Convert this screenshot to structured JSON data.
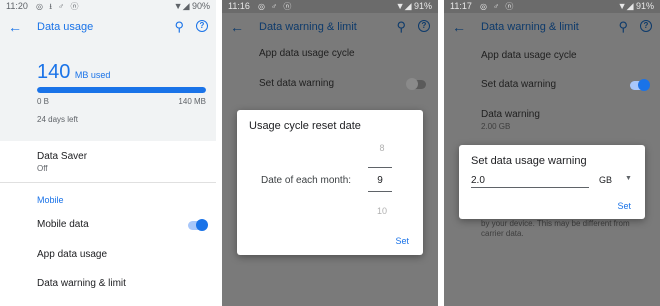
{
  "screen1": {
    "status": {
      "time": "11:20",
      "icons": "◎ ⭳ ♂ ⓝ",
      "right": "▼◢ 90%"
    },
    "title": "Data usage",
    "usage": {
      "amount": "140",
      "unit": "MB used",
      "min_label": "0 B",
      "max_label": "140 MB",
      "fill_fraction": 1.0,
      "days_left": "24 days left"
    },
    "data_saver": {
      "label": "Data Saver",
      "value": "Off"
    },
    "section_mobile": "Mobile",
    "mobile_data": {
      "label": "Mobile data",
      "toggle": "on"
    },
    "app_data_usage": "App data usage",
    "data_warning_limit": "Data warning & limit"
  },
  "screen2": {
    "status": {
      "time": "11:16",
      "icons": "◎ ♂ ⓝ",
      "right": "▼◢ 91%"
    },
    "title": "Data warning & limit",
    "cycle": "App data usage cycle",
    "set_warning": {
      "label": "Set data warning",
      "toggle": "off"
    },
    "dialog": {
      "title": "Usage cycle reset date",
      "label": "Date of each month:",
      "prev": "8",
      "value": "9",
      "next": "10",
      "button": "Set"
    }
  },
  "screen3": {
    "status": {
      "time": "11:17",
      "icons": "◎ ♂ ⓝ",
      "right": "▼◢ 91%"
    },
    "title": "Data warning & limit",
    "cycle": "App data usage cycle",
    "set_warning": {
      "label": "Set data warning",
      "toggle": "on"
    },
    "warning": {
      "label": "Data warning",
      "value": "2.00 GB"
    },
    "footnote": "by your device. This may be different from\ncarrier data.",
    "dialog": {
      "title": "Set data usage warning",
      "value": "2.0",
      "unit": "GB",
      "button": "Set"
    }
  },
  "colors": {
    "accent": "#1a73e8",
    "scrim_bg": "#7a7a7a"
  },
  "icons": [
    "back-arrow-icon",
    "search-icon",
    "help-icon",
    "dropdown-caret-icon"
  ]
}
